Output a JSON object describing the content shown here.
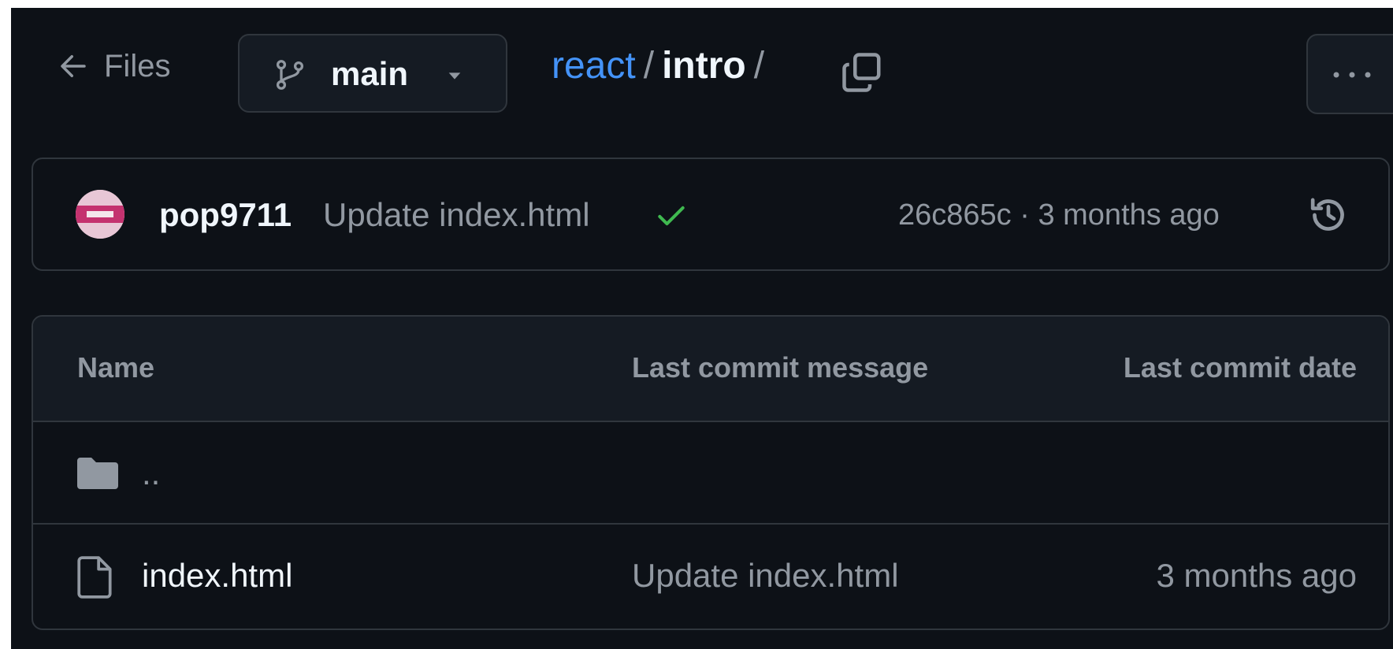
{
  "nav": {
    "back_label": "Files",
    "branch_label": "main",
    "breadcrumb": {
      "repo": "react",
      "separator": "/",
      "dir": "intro",
      "trailing_separator": "/"
    }
  },
  "commit": {
    "author": "pop9711",
    "message": "Update index.html",
    "sha": "26c865c",
    "meta_separator": "·",
    "time": "3 months ago",
    "status_color": "#3fb950"
  },
  "table": {
    "headers": {
      "name": "Name",
      "message": "Last commit message",
      "date": "Last commit date"
    },
    "rows": [
      {
        "name": "..",
        "message": "",
        "date": "",
        "icon": "folder-icon"
      },
      {
        "name": "index.html",
        "message": "Update index.html",
        "date": "3 months ago",
        "icon": "file-icon"
      }
    ]
  },
  "colors": {
    "background": "#0d1117",
    "link": "#4493f8",
    "muted": "#9198a1",
    "border": "#30363d"
  }
}
